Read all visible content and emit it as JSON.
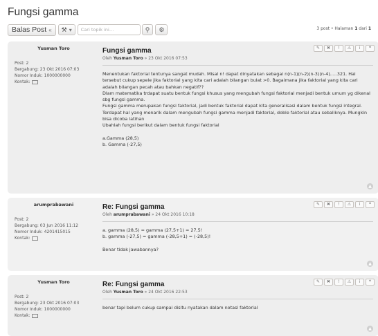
{
  "topic": {
    "title": "Fungsi gamma"
  },
  "toolbar": {
    "reply_label": "Balas Post",
    "search_placeholder": "Cari topik ini…",
    "pagination": {
      "count": "3 post",
      "separator": " • Halaman ",
      "current": "1",
      "of": " dari ",
      "total": "1"
    }
  },
  "posts": [
    {
      "author": "Yusman Toro",
      "profile": [
        "Post: 2",
        "Bergabung: 23 Okt 2016 07:03",
        "Nomor Induk: 1000000000",
        "Kontak:"
      ],
      "title": "Fungsi gamma",
      "byline_prefix": "Oleh ",
      "byline_author": "Yusman Toro",
      "byline_date": " » 23 Okt 2016 07:53",
      "lines": [
        "Menentukan faktorial tentunya sangat mudah. Misal n! dapat dinyatakan sebagai n(n-1)(n-2)(n-3)(n-4).....321. Hal tersebut cukup sepele jika faktorial yang kita cari adalah bilangan bulat >0. Bagaimana jika faktorial yang kita cari adalah bilangan pecah atau bahkan negatif??",
        "Dlam matematika trdapat suatu bentuk fungsi khusus yang mengubah fungsi faktorial menjadi bentuk umum yg dikenal sbg fungsi gamma.",
        "Fungsi gamma merupakan fungsi faktorial, jadi bentuk faktorial dapat kita generalisasi dalam bentuk fungsi integral. Terdapat hal yang menarik dalam mengubah fungsi gamma menjadi faktorial, doble faktorial atau sebaliknya. Mungkin bisa dicoba latihan",
        "Ubahlah fungsi berikut dalam bentuk fungsi faktorial",
        "",
        "a.Gamma (28,5)",
        "b. Gamma (-27,5)"
      ]
    },
    {
      "author": "arumprabawani",
      "profile": [
        "Post: 2",
        "Bergabung: 03 Jun 2016 11:12",
        "Nomor Induk: 4201415015",
        "Kontak:"
      ],
      "title": "Re: Fungsi gamma",
      "byline_prefix": "Oleh ",
      "byline_author": "arumprabawani",
      "byline_date": " » 24 Okt 2016 10:18",
      "lines": [
        "a. gamma (28,5) = gamma (27,5+1) = 27,5!",
        "b. gamma (-27,5) = gamma (-28,5+1) = (-28,5)!",
        "",
        "Benar tidak jawabannya?"
      ]
    },
    {
      "author": "Yusman Toro",
      "profile": [
        "Post: 2",
        "Bergabung: 23 Okt 2016 07:03",
        "Nomor Induk: 1000000000",
        "Kontak:"
      ],
      "title": "Re: Fungsi gamma",
      "byline_prefix": "Oleh ",
      "byline_author": "Yusman Toro",
      "byline_date": " » 24 Okt 2016 22:53",
      "lines": [
        "benar tapi belum cukup sampai disitu nyatakan dalam notasi faktorial"
      ]
    }
  ],
  "icons": {
    "reply": "reply-icon",
    "tools": "wrench-icon",
    "search": "search-icon",
    "advanced": "gear-icon",
    "edit": "edit-icon",
    "delete": "delete-icon",
    "report": "report-icon",
    "warn": "warn-icon",
    "info": "info-icon",
    "quote": "quote-icon",
    "top": "back-to-top-icon"
  }
}
